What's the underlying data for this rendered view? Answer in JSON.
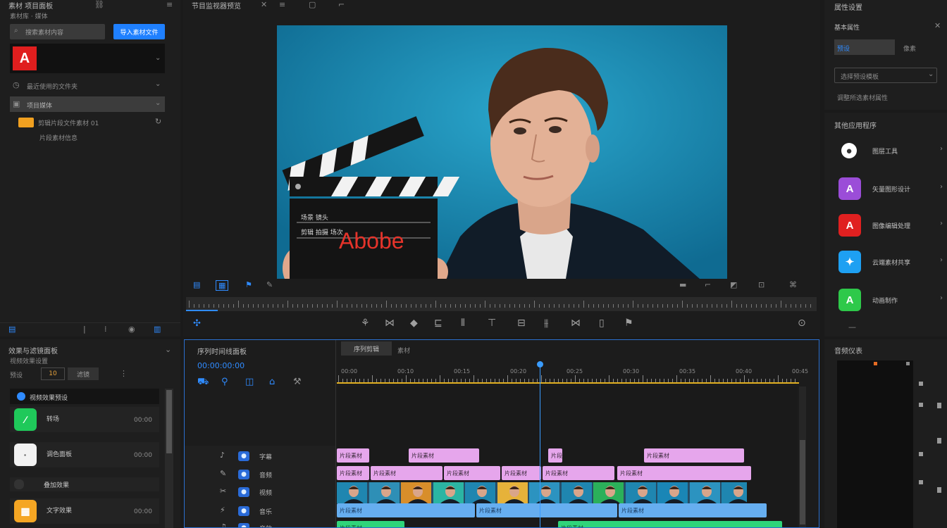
{
  "left_panel": {
    "title": "素材 项目面板",
    "subtitle": "素材库 · 媒体",
    "search_placeholder": "搜索素材内容",
    "import_button": "导入素材文件",
    "brand_item": "",
    "section1": "最近使用的文件夹",
    "section2": "项目媒体",
    "file_row": "剪辑片段文件素材 01",
    "file_row2": "片段素材信息"
  },
  "effects_panel": {
    "title": "效果与滤镜面板",
    "subtitle": "视频效果设置",
    "tab_a": "预设",
    "tab_b": "10",
    "tab_c": "滤镜",
    "group_label": "视频效果预设",
    "items": [
      {
        "name": "转场",
        "meta": "00:00",
        "color": "#1fc95a",
        "glyph": "∕"
      },
      {
        "name": "调色面板",
        "meta": "00:00",
        "color": "#f2f2f2",
        "glyph": "·"
      },
      {
        "name": "叠加效果",
        "meta": "",
        "color": "#333333",
        "glyph": ""
      },
      {
        "name": "文字效果",
        "meta": "00:00",
        "color": "#f5a623",
        "glyph": "▦"
      }
    ]
  },
  "preview": {
    "title": "节目监视器预览",
    "clapper_text": "Abobe",
    "clapper_top": "场景 镜头",
    "clapper_mid": "剪辑 拍摄 场次"
  },
  "right_panel": {
    "title": "属性设置",
    "section": "基本属性",
    "field_value": "预设",
    "field_unit": "像素",
    "dropdown": "选择预设模板",
    "note": "调整所选素材属性",
    "apps_title": "其他应用程序",
    "apps": [
      {
        "name": "图层工具",
        "color": "#ffffff",
        "glyph": "●"
      },
      {
        "name": "矢量图形设计",
        "color": "#9b4dd8",
        "glyph": "A"
      },
      {
        "name": "图像编辑处理",
        "color": "#e02020",
        "glyph": "A"
      },
      {
        "name": "云端素材共享",
        "color": "#1ea0f2",
        "glyph": "✦"
      },
      {
        "name": "动画制作",
        "color": "#2ec94a",
        "glyph": "A"
      }
    ]
  },
  "timeline": {
    "title": "序列时间线面板",
    "timecode": "00:00:00:00",
    "tab_active": "序列剪辑",
    "tab_inactive": "素材",
    "ruler_labels": [
      "00:00",
      "00:10",
      "00:15",
      "00:20",
      "00:25",
      "00:30",
      "00:35",
      "00:40",
      "00:45"
    ],
    "tracks": [
      {
        "label": "字幕"
      },
      {
        "label": "音频"
      },
      {
        "label": "视频"
      },
      {
        "label": "音乐"
      },
      {
        "label": "音效"
      }
    ],
    "clip_text": "片段素材"
  },
  "meter_panel": {
    "title": "音频仪表"
  },
  "colors": {
    "accent": "#2f8bff",
    "pink_clip": "#e6a6ec",
    "blue_clip": "#66aef0",
    "green_clip": "#2fd47a",
    "bg": "#1a1a1a"
  }
}
